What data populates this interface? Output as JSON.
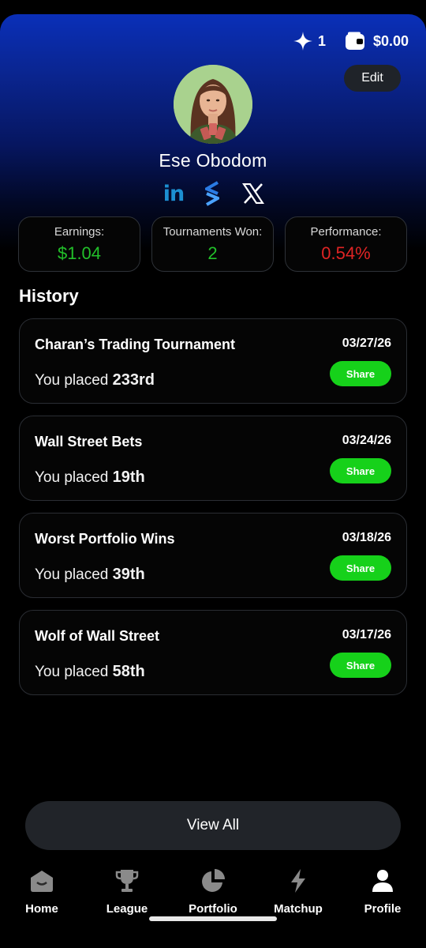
{
  "header": {
    "star_count": "1",
    "balance": "$0.00",
    "edit_label": "Edit"
  },
  "profile": {
    "name": "Ese Obodom",
    "socials": [
      {
        "icon": "linkedin-icon",
        "text": "in"
      },
      {
        "icon": "stocktwits-icon"
      },
      {
        "icon": "x-icon"
      }
    ]
  },
  "stats": [
    {
      "label": "Earnings:",
      "value": "$1.04",
      "color": "#22c02a"
    },
    {
      "label": "Tournaments Won:",
      "value": "2",
      "color": "#22c02a"
    },
    {
      "label": "Performance:",
      "value": "0.54%",
      "color": "#e02424"
    }
  ],
  "history": {
    "title": "History",
    "placed_prefix": "You placed",
    "share_label": "Share",
    "items": [
      {
        "name": "Charan’s Trading Tournament",
        "date": "03/27/26",
        "rank": "233rd"
      },
      {
        "name": "Wall Street Bets",
        "date": "03/24/26",
        "rank": "19th"
      },
      {
        "name": "Worst Portfolio Wins",
        "date": "03/18/26",
        "rank": "39th"
      },
      {
        "name": "Wolf of Wall Street",
        "date": "03/17/26",
        "rank": "58th"
      }
    ]
  },
  "view_all_label": "View All",
  "nav": {
    "items": [
      {
        "label": "Home",
        "icon": "home-icon",
        "active": false
      },
      {
        "label": "League",
        "icon": "trophy-icon",
        "active": false
      },
      {
        "label": "Portfolio",
        "icon": "pie-chart-icon",
        "active": false
      },
      {
        "label": "Matchup",
        "icon": "lightning-icon",
        "active": false
      },
      {
        "label": "Profile",
        "icon": "person-icon",
        "active": true
      }
    ]
  },
  "colors": {
    "accent_green": "#16d11a",
    "positive": "#22c02a",
    "negative": "#e02424",
    "linkedin": "#1c8fd1",
    "stocktwits": "#2a7be4"
  }
}
